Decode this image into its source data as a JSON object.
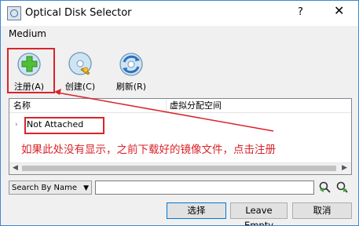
{
  "window": {
    "title": "Optical Disk Selector",
    "help": "?",
    "close": "✕"
  },
  "menu": {
    "medium": "Medium"
  },
  "toolbar": {
    "add_label": "注册(A)",
    "create_label": "创建(C)",
    "refresh_label": "刷新(R)"
  },
  "table": {
    "columns": [
      "名称",
      "虚拟分配空间"
    ],
    "rows": [
      {
        "expander": "›",
        "name": "Not Attached"
      }
    ]
  },
  "annotation": {
    "text": "如果此处没有显示，之前下载好的镜像文件，点击注册"
  },
  "search": {
    "mode": "Search By Name",
    "value": ""
  },
  "buttons": {
    "choose": "选择",
    "leave_empty": "Leave Empty",
    "cancel": "取消"
  },
  "colors": {
    "annotation_red": "#d9242b",
    "accent_blue": "#0078d7"
  }
}
